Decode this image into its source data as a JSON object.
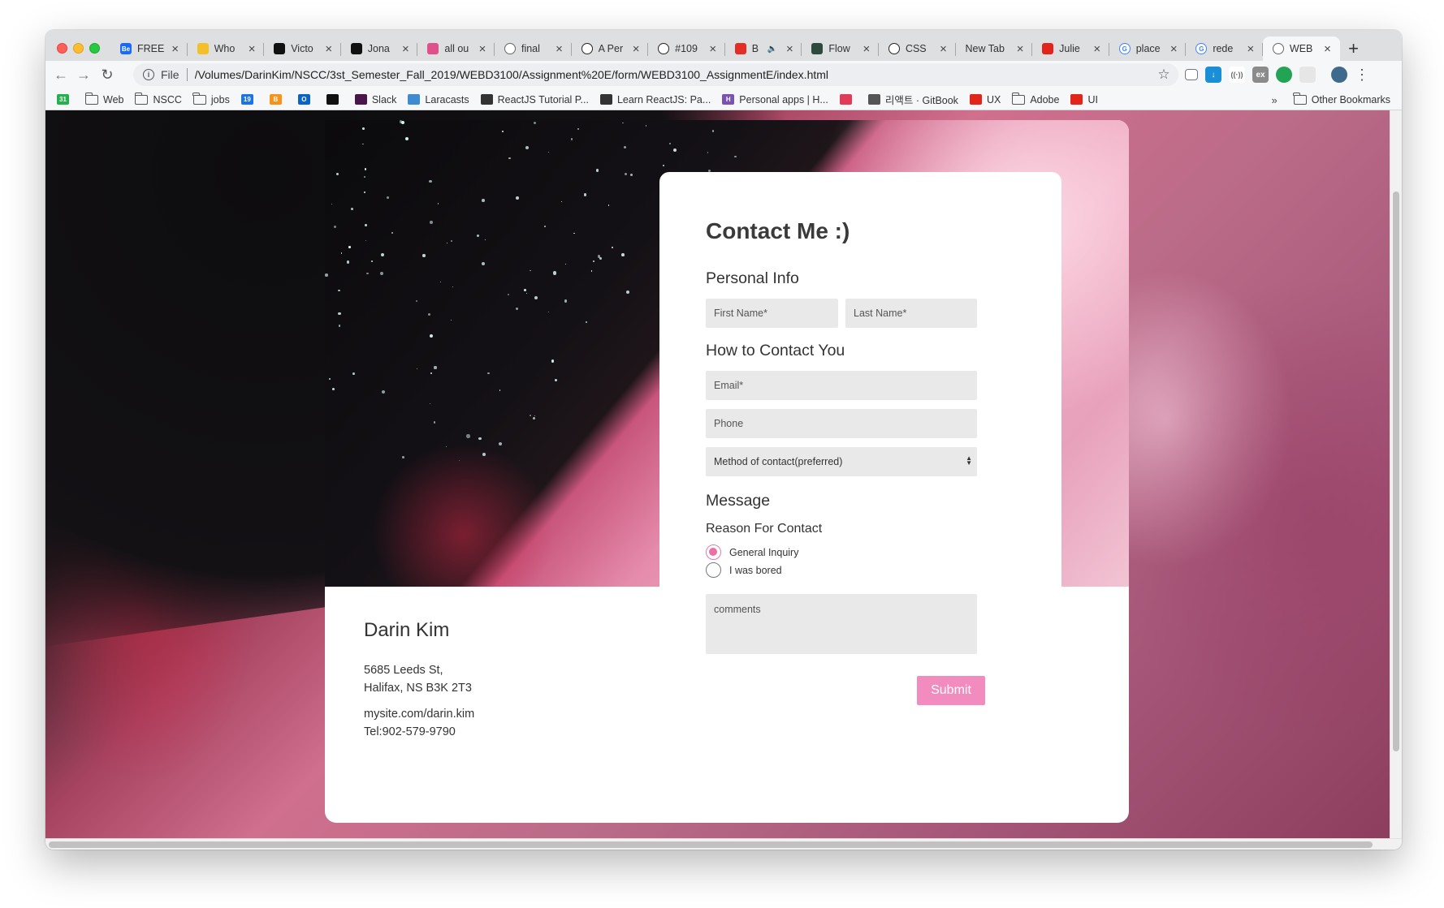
{
  "browser": {
    "tabs": [
      {
        "title": "FREE",
        "favicon": "behance-icon",
        "favicon_color": "#1769ff",
        "favicon_text": "Be"
      },
      {
        "title": "Who",
        "favicon": "shield-icon",
        "favicon_color": "#f3c02a",
        "favicon_text": ""
      },
      {
        "title": "Victo",
        "favicon": "circle-icon",
        "favicon_color": "#111111",
        "favicon_text": ""
      },
      {
        "title": "Jona",
        "favicon": "square-icon",
        "favicon_color": "#111111",
        "favicon_text": ""
      },
      {
        "title": "all ou",
        "favicon": "color-wheel-icon",
        "favicon_color": "#e0508a",
        "favicon_text": ""
      },
      {
        "title": "final",
        "favicon": "globe-icon",
        "favicon_color": "#666666",
        "favicon_text": ""
      },
      {
        "title": "A Per",
        "favicon": "codepen-icon",
        "favicon_color": "#222222",
        "favicon_text": ""
      },
      {
        "title": "#109",
        "favicon": "codepen-icon",
        "favicon_color": "#222222",
        "favicon_text": ""
      },
      {
        "title": "B",
        "favicon": "youtube-icon",
        "favicon_color": "#e52d27",
        "favicon_text": "",
        "audio": true
      },
      {
        "title": "Flow",
        "favicon": "vue-icon",
        "favicon_color": "#2c4a3e",
        "favicon_text": ""
      },
      {
        "title": "CSS",
        "favicon": "codepen-icon",
        "favicon_color": "#222222",
        "favicon_text": ""
      },
      {
        "title": "New Tab",
        "favicon": "",
        "favicon_color": "",
        "favicon_text": ""
      },
      {
        "title": "Julie",
        "favicon": "adobe-icon",
        "favicon_color": "#e1251b",
        "favicon_text": ""
      },
      {
        "title": "place",
        "favicon": "google-icon",
        "favicon_color": "#4285f4",
        "favicon_text": "G"
      },
      {
        "title": "rede",
        "favicon": "google-icon",
        "favicon_color": "#4285f4",
        "favicon_text": "G"
      },
      {
        "title": "WEB",
        "favicon": "globe-icon",
        "favicon_color": "#666666",
        "favicon_text": "",
        "active": true
      }
    ],
    "omnibox": {
      "scheme_label": "File",
      "url": "/Volumes/DarinKim/NSCC/3st_Semester_Fall_2019/WEBD3100/Assignment%20E/form/WEBD3100_AssignmentE/index.html"
    },
    "bookmarks": [
      {
        "label": "",
        "icon": "calendar-icon",
        "color": "#22b14c",
        "text": "31"
      },
      {
        "label": "Web",
        "icon": "folder-icon"
      },
      {
        "label": "NSCC",
        "icon": "folder-icon"
      },
      {
        "label": "jobs",
        "icon": "folder-icon"
      },
      {
        "label": "",
        "icon": "calendar-blue-icon",
        "color": "#1a73e8",
        "text": "19"
      },
      {
        "label": "",
        "icon": "bitcoin-icon",
        "color": "#f7931a",
        "text": "B"
      },
      {
        "label": "",
        "icon": "outlook-icon",
        "color": "#0a64c8",
        "text": "O"
      },
      {
        "label": "",
        "icon": "github-icon",
        "color": "#111111",
        "text": ""
      },
      {
        "label": "Slack",
        "icon": "slack-icon",
        "color": "#4a154b",
        "text": ""
      },
      {
        "label": "Laracasts",
        "icon": "laracasts-icon",
        "color": "#3e8ccf",
        "text": ""
      },
      {
        "label": "ReactJS Tutorial P...",
        "icon": "doc-icon",
        "color": "#333333",
        "text": ""
      },
      {
        "label": "Learn ReactJS: Pa...",
        "icon": "doc-icon",
        "color": "#333333",
        "text": ""
      },
      {
        "label": "Personal apps | H...",
        "icon": "heroku-icon",
        "color": "#7952b3",
        "text": "H"
      },
      {
        "label": "",
        "icon": "react-icon",
        "color": "#e03c5a",
        "text": ""
      },
      {
        "label": "리액트 · GitBook",
        "icon": "book-icon",
        "color": "#555555",
        "text": ""
      },
      {
        "label": "UX",
        "icon": "adobe-icon",
        "color": "#e1251b",
        "text": ""
      },
      {
        "label": "Adobe",
        "icon": "folder-icon"
      },
      {
        "label": "UI",
        "icon": "adobe-icon",
        "color": "#e1251b",
        "text": ""
      }
    ],
    "bookmarks_overflow": "»",
    "other_bookmarks": "Other Bookmarks"
  },
  "page": {
    "contact_card": {
      "name": "Darin Kim",
      "address_line1": "5685 Leeds St,",
      "address_line2": "Halifax, NS B3K 2T3",
      "website": "mysite.com/darin.kim",
      "phone": "Tel:902-579-9790"
    },
    "form": {
      "title": "Contact Me :)",
      "personal_info_heading": "Personal Info",
      "first_name_placeholder": "First Name*",
      "last_name_placeholder": "Last Name*",
      "contact_heading": "How to Contact You",
      "email_placeholder": "Email*",
      "phone_placeholder": "Phone",
      "method_select": {
        "selected": "Method of contact(preferred)"
      },
      "message_heading": "Message",
      "reason_label": "Reason For Contact",
      "reasons": [
        {
          "label": "General Inquiry",
          "checked": true
        },
        {
          "label": "I was bored",
          "checked": false
        }
      ],
      "comments_placeholder": "comments",
      "submit_label": "Submit"
    },
    "accent_color": "#f28cbf"
  }
}
